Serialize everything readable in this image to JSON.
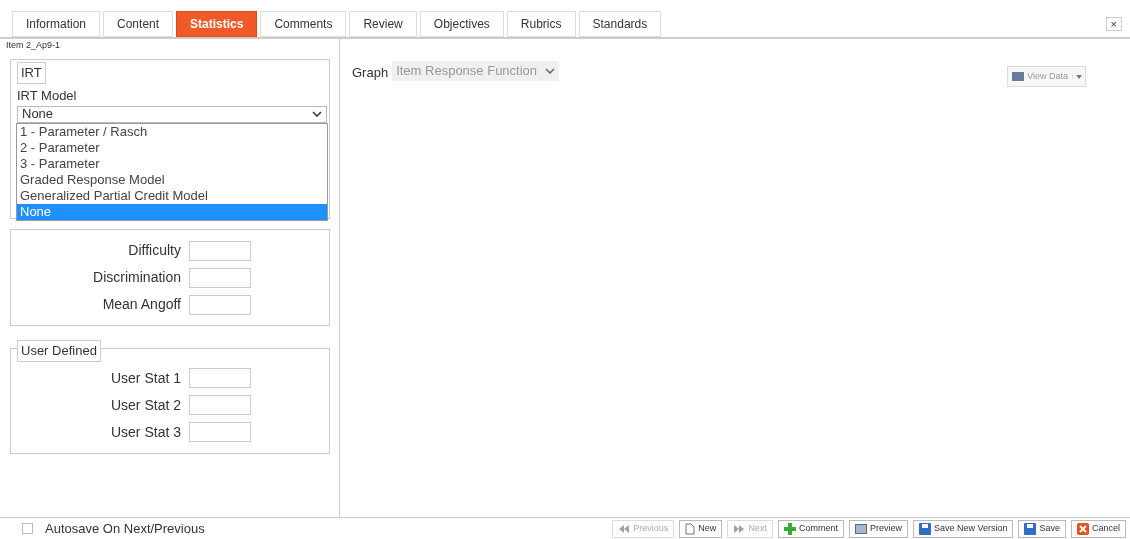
{
  "tabs": [
    {
      "label": "Information",
      "selected": false
    },
    {
      "label": "Content",
      "selected": false
    },
    {
      "label": "Statistics",
      "selected": true
    },
    {
      "label": "Comments",
      "selected": false
    },
    {
      "label": "Review",
      "selected": false
    },
    {
      "label": "Objectives",
      "selected": false
    },
    {
      "label": "Rubrics",
      "selected": false
    },
    {
      "label": "Standards",
      "selected": false
    }
  ],
  "close_button": "×",
  "item_name": "Item 2_Ap9-1",
  "irt": {
    "legend": "IRT",
    "model_label": "IRT Model",
    "model_value": "None",
    "options": [
      {
        "label": "1 - Parameter / Rasch",
        "selected": false
      },
      {
        "label": "2 - Parameter",
        "selected": false
      },
      {
        "label": "3 - Parameter",
        "selected": false
      },
      {
        "label": "Graded Response Model",
        "selected": false
      },
      {
        "label": "Generalized Partial Credit Model",
        "selected": false
      },
      {
        "label": "None",
        "selected": true
      }
    ]
  },
  "statistics": {
    "fields": [
      {
        "label": "Difficulty"
      },
      {
        "label": "Discrimination"
      },
      {
        "label": "Mean Angoff"
      }
    ]
  },
  "user_defined": {
    "legend": "User Defined",
    "fields": [
      {
        "label": "User Stat 1"
      },
      {
        "label": "User Stat 2"
      },
      {
        "label": "User Stat 3"
      }
    ]
  },
  "graph": {
    "label": "Graph",
    "value": "Item Response Function"
  },
  "view_data_button": "View Data",
  "autosave": {
    "label": "Autosave On Next/Previous",
    "checked": false
  },
  "buttons": [
    {
      "label": "Previous",
      "kind": "previous",
      "disabled": true
    },
    {
      "label": "New",
      "kind": "new",
      "disabled": false
    },
    {
      "label": "Next",
      "kind": "next",
      "disabled": true
    },
    {
      "label": "Comment",
      "kind": "comment",
      "disabled": false
    },
    {
      "label": "Preview",
      "kind": "preview",
      "disabled": false
    },
    {
      "label": "Save New Version",
      "kind": "save",
      "disabled": false
    },
    {
      "label": "Save",
      "kind": "save",
      "disabled": false
    },
    {
      "label": "Cancel",
      "kind": "cancel",
      "disabled": false
    }
  ]
}
